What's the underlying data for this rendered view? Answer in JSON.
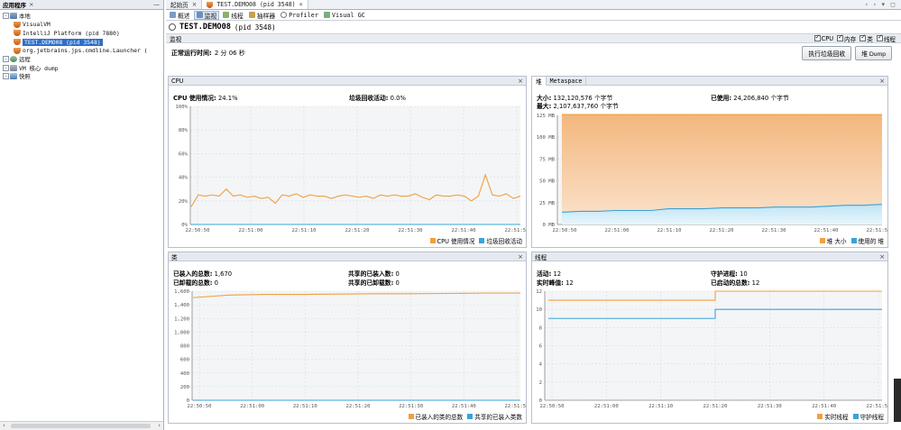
{
  "left_panel": {
    "tab_label": "应用程序",
    "tree": [
      {
        "label": "本地",
        "level": 0,
        "icon": "host-icon",
        "expander": "-"
      },
      {
        "label": "VisualVM",
        "level": 1,
        "icon": "java-icon"
      },
      {
        "label": "IntelliJ Platform (pid 7880)",
        "level": 1,
        "icon": "java-icon"
      },
      {
        "label": "TEST.DEMO08 (pid 3548)",
        "level": 1,
        "icon": "java-icon",
        "selected": true
      },
      {
        "label": "org.jetbrains.jps.cmdline.Launcher (",
        "level": 1,
        "icon": "java-icon"
      },
      {
        "label": "远程",
        "level": 0,
        "icon": "remote-icon",
        "expander": "-"
      },
      {
        "label": "VM 核心 dump",
        "level": 0,
        "icon": "vm-icon",
        "expander": "-"
      },
      {
        "label": "快照",
        "level": 0,
        "icon": "snapshot-icon",
        "expander": "-"
      }
    ]
  },
  "doc_tabs": [
    {
      "label": "起始页",
      "active": false
    },
    {
      "label": "TEST.DEMO08 (pid 3548)",
      "active": true
    }
  ],
  "sub_tabs": [
    {
      "label": "概述",
      "icon": "overview-icon",
      "active": false
    },
    {
      "label": "监视",
      "icon": "monitor-icon",
      "active": true
    },
    {
      "label": "线程",
      "icon": "threads-icon",
      "active": false
    },
    {
      "label": "抽样器",
      "icon": "sampler-icon",
      "active": false
    },
    {
      "label": "Profiler",
      "icon": "profiler-icon",
      "active": false
    },
    {
      "label": "Visual GC",
      "icon": "visualgc-icon",
      "active": false
    }
  ],
  "app_title": {
    "name": "TEST.DEMO08",
    "pid": "(pid 3548)"
  },
  "monitor_bar": {
    "label": "监视",
    "checks": [
      {
        "label": "CPU",
        "checked": true
      },
      {
        "label": "内存",
        "checked": true
      },
      {
        "label": "类",
        "checked": true
      },
      {
        "label": "线程",
        "checked": true
      }
    ]
  },
  "uptime": {
    "label": "正常运行时间:",
    "value": "2 分 06 秒"
  },
  "buttons": {
    "gc": "执行垃圾回收",
    "heap_dump": "堆 Dump"
  },
  "colors": {
    "orange": "#f0a040",
    "blue": "#3aa3d8",
    "orange_fill": "#f6c79a",
    "blue_fill": "#cdeaf6"
  },
  "time_ticks": [
    "22:50:50",
    "22:51:00",
    "22:51:10",
    "22:51:20",
    "22:51:30",
    "22:51:40",
    "22:51:50"
  ],
  "cpu_panel": {
    "title": "CPU",
    "usage_label": "CPU 使用情况:",
    "usage_value": "24.1%",
    "gc_label": "垃圾回收活动:",
    "gc_value": "0.0%",
    "legend": [
      "CPU 使用情况",
      "垃圾回收活动"
    ]
  },
  "heap_panel": {
    "tabs": [
      "堆",
      "Metaspace"
    ],
    "size_label": "大小:",
    "size_value": "132,120,576 个字节",
    "max_label": "最大:",
    "max_value": "2,107,637,760 个字节",
    "used_label": "已使用:",
    "used_value": "24,206,840 个字节",
    "legend": [
      "堆 大小",
      "使用的 堆"
    ]
  },
  "classes_panel": {
    "title": "类",
    "loaded_label": "已装入的总数:",
    "loaded_value": "1,670",
    "unloaded_label": "已卸载的总数:",
    "unloaded_value": "0",
    "shared_loaded_label": "共享的已装入数:",
    "shared_loaded_value": "0",
    "shared_unloaded_label": "共享的已卸载数:",
    "shared_unloaded_value": "0",
    "legend": [
      "已装入的类的总数",
      "共享的已装入类数"
    ]
  },
  "threads_panel": {
    "title": "线程",
    "live_label": "活动:",
    "live_value": "12",
    "peak_label": "实时峰值:",
    "peak_value": "12",
    "daemon_label": "守护进程:",
    "daemon_value": "10",
    "started_label": "已启动的总数:",
    "started_value": "12",
    "legend": [
      "实时线程",
      "守护线程"
    ]
  },
  "chart_data": [
    {
      "type": "line",
      "title": "CPU",
      "ylim": [
        0,
        100
      ],
      "yticks": [
        "0%",
        "20%",
        "40%",
        "60%",
        "80%",
        "100%"
      ],
      "x": [
        "22:50:50",
        "22:51:00",
        "22:51:10",
        "22:51:20",
        "22:51:30",
        "22:51:40",
        "22:51:50"
      ],
      "series": [
        {
          "name": "CPU 使用情况",
          "values": [
            15,
            25,
            24,
            25,
            24,
            30,
            24,
            25,
            23,
            24,
            22,
            23,
            18,
            25,
            24,
            26,
            23,
            25,
            24,
            24,
            22,
            24,
            25,
            24,
            23,
            24,
            22,
            25,
            24,
            25,
            24,
            24,
            26,
            23,
            21,
            25,
            24,
            24,
            25,
            24,
            20,
            24,
            42,
            25,
            24,
            26,
            22,
            24
          ]
        },
        {
          "name": "垃圾回收活动",
          "values": [
            0,
            0
          ]
        }
      ]
    },
    {
      "type": "area",
      "title": "堆",
      "ylim": [
        0,
        125
      ],
      "yticks": [
        "0 MB",
        "25 MB",
        "50 MB",
        "75 MB",
        "100 MB",
        "125 MB"
      ],
      "series": [
        {
          "name": "堆 大小",
          "values": [
            126,
            126
          ]
        },
        {
          "name": "使用的 堆",
          "values": [
            14,
            15,
            15,
            16,
            16,
            16,
            18,
            18,
            18,
            19,
            19,
            19,
            20,
            20,
            20,
            21,
            22,
            22,
            23
          ]
        }
      ]
    },
    {
      "type": "line",
      "title": "类",
      "ylim": [
        0,
        1700
      ],
      "yticks": [
        "0",
        "200",
        "400",
        "600",
        "800",
        "1,000",
        "1,200",
        "1,400",
        "1,600"
      ],
      "series": [
        {
          "name": "已装入的类的总数",
          "values": [
            1600,
            1640,
            1650,
            1650,
            1655,
            1660,
            1660,
            1665,
            1670,
            1670
          ]
        },
        {
          "name": "共享的已装入类数",
          "values": [
            0,
            0
          ]
        }
      ]
    },
    {
      "type": "line",
      "title": "线程",
      "ylim": [
        0,
        12
      ],
      "yticks": [
        "0",
        "2",
        "4",
        "6",
        "8",
        "10",
        "12"
      ],
      "series": [
        {
          "name": "实时线程",
          "values": [
            11,
            11,
            12,
            12,
            12
          ]
        },
        {
          "name": "守护线程",
          "values": [
            9,
            9,
            10,
            10,
            10
          ]
        }
      ]
    }
  ]
}
